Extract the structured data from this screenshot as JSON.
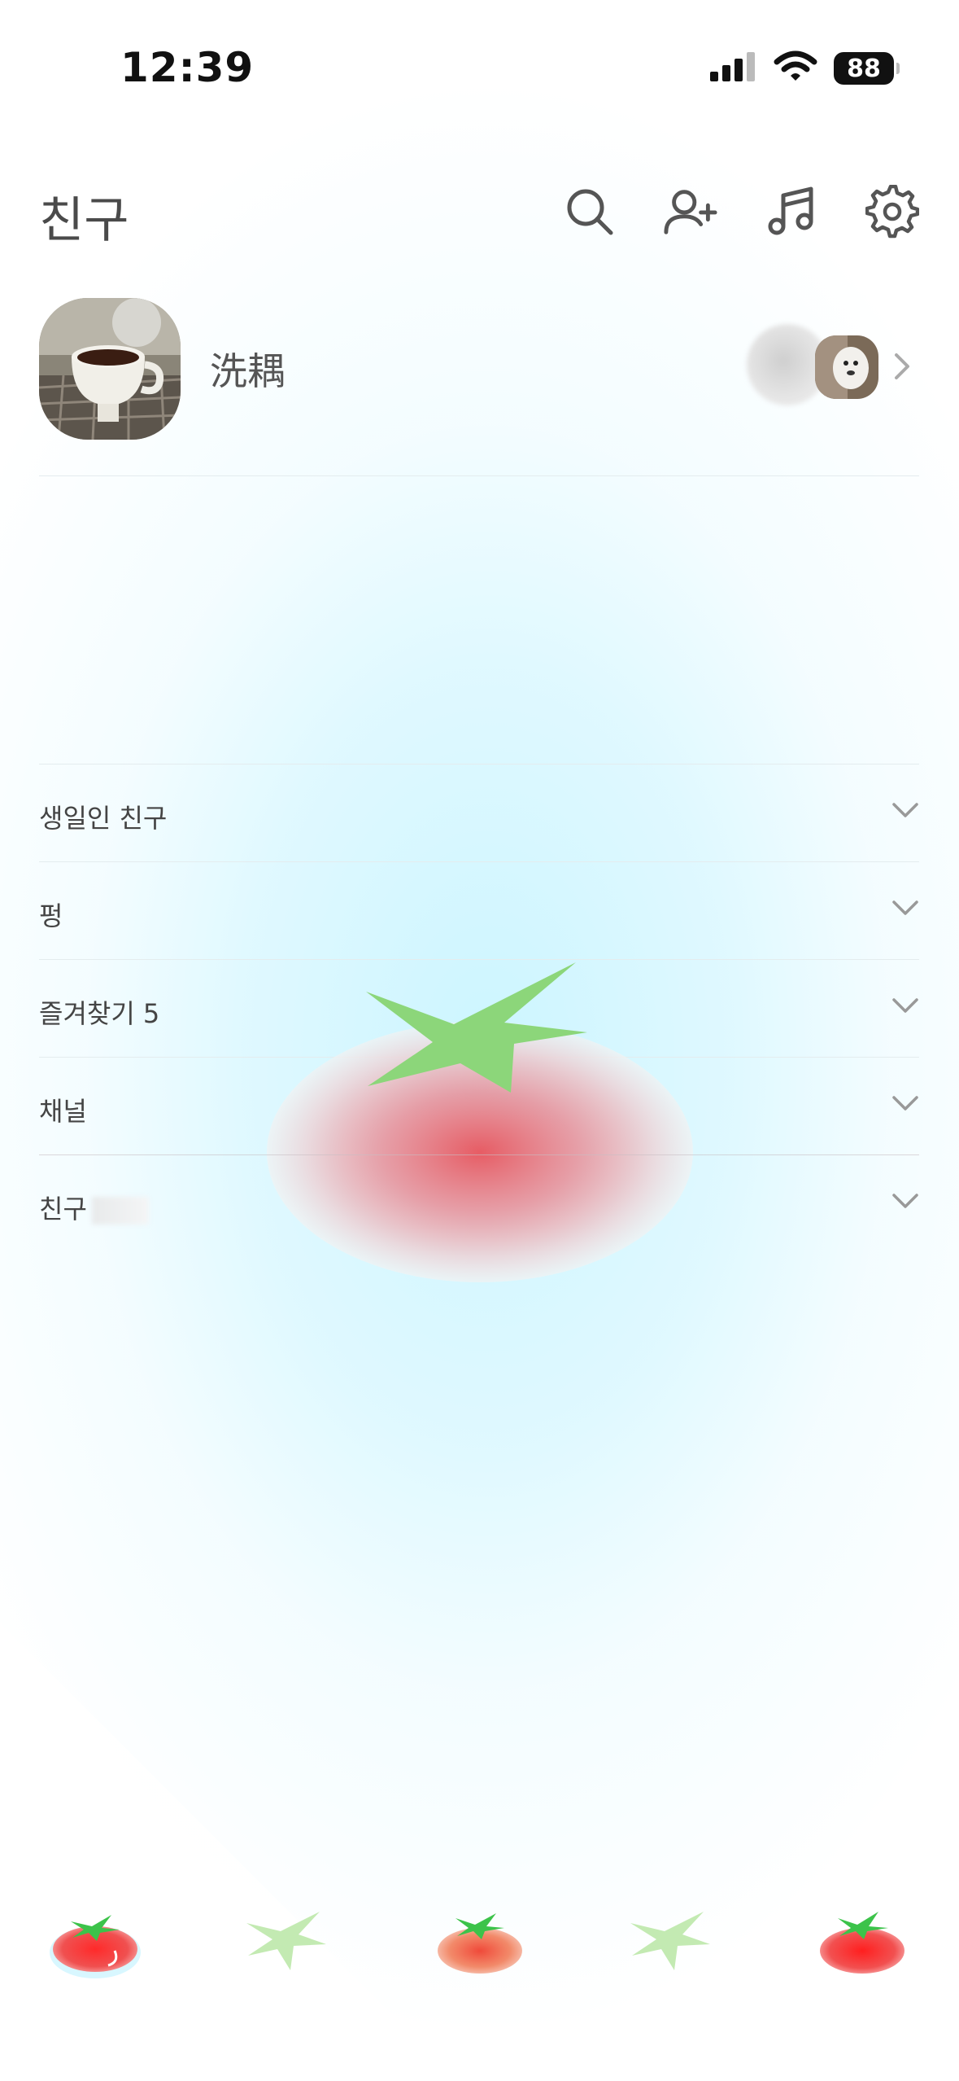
{
  "status_bar": {
    "time": "12:39",
    "battery": "88",
    "icons": [
      "cellular-signal-icon",
      "wifi-icon",
      "battery-icon"
    ]
  },
  "header": {
    "title": "친구",
    "icons": [
      "search-icon",
      "add-friend-icon",
      "music-icon",
      "settings-icon"
    ]
  },
  "profile": {
    "name": "洗耦"
  },
  "sections": [
    {
      "label": "생일인 친구"
    },
    {
      "label": "펑"
    },
    {
      "label": "즐겨찾기 5"
    },
    {
      "label": "채널"
    },
    {
      "label": "친구"
    }
  ],
  "tab_bar": {
    "tabs": [
      "friends-tab",
      "chats-tab",
      "open-chat-tab",
      "shopping-tab",
      "more-tab"
    ],
    "active": "friends-tab"
  },
  "colors": {
    "background_tint": "#CCF5FF",
    "tomato_red": "#E8545C",
    "leaf_green": "#8CD67A",
    "text_gray": "#444444"
  }
}
